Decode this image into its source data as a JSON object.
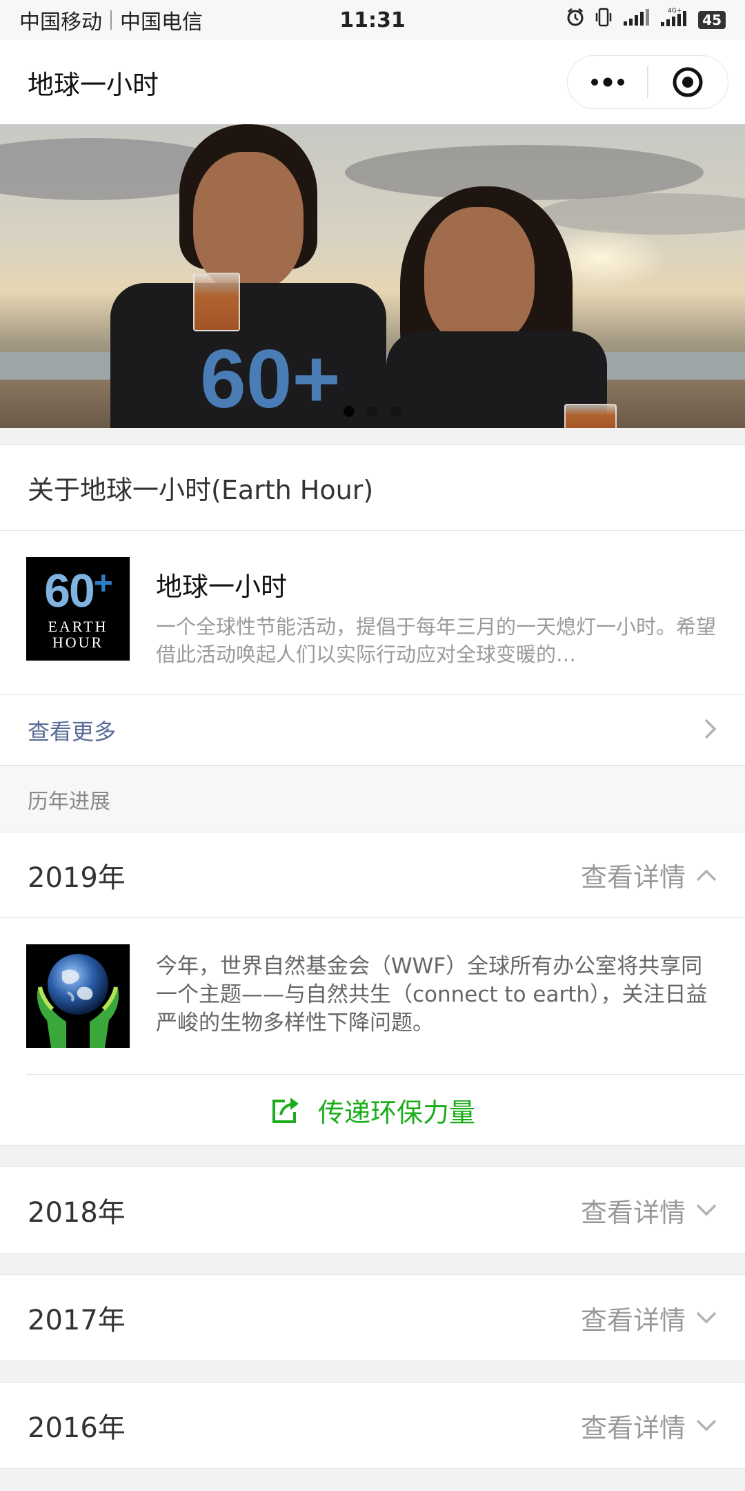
{
  "status_bar": {
    "carrier1": "中国移动",
    "carrier2": "中国电信",
    "time": "11:31",
    "battery": "45",
    "network": "4G+"
  },
  "nav": {
    "title": "地球一小时"
  },
  "banner": {
    "shirt_text": "60+",
    "slides": 3,
    "active_slide": 1
  },
  "about": {
    "heading": "关于地球一小时(Earth Hour)",
    "card_title": "地球一小时",
    "card_desc": "一个全球性节能活动，提倡于每年三月的一天熄灯一小时。希望借此活动唤起人们以实际行动应对全球变暖的…",
    "logo_number": "60",
    "logo_plus": "+",
    "logo_line1": "EARTH",
    "logo_line2": "HOUR",
    "more_label": "查看更多"
  },
  "progress": {
    "section_label": "历年进展",
    "detail_label": "查看详情",
    "years": [
      {
        "label": "2019年",
        "expanded": true,
        "desc": "今年，世界自然基金会（WWF）全球所有办公室将共享同一个主题——与自然共生（connect to earth），关注日益严峻的生物多样性下降问题。",
        "share_label": "传递环保力量"
      },
      {
        "label": "2018年",
        "expanded": false
      },
      {
        "label": "2017年",
        "expanded": false
      },
      {
        "label": "2016年",
        "expanded": false
      }
    ]
  },
  "colors": {
    "link": "#576b95",
    "accent_green": "#1aad19",
    "muted": "#999999"
  }
}
